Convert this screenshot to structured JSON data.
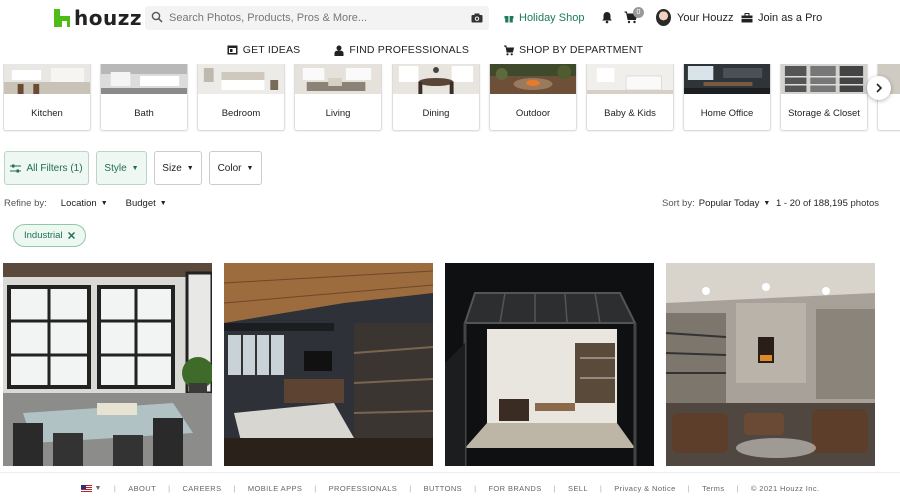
{
  "brand": {
    "name": "houzz",
    "color": "#4dbc15"
  },
  "search": {
    "placeholder": "Search Photos, Products, Pros & More..."
  },
  "header": {
    "holiday_shop": "Holiday Shop",
    "cart_count": "0",
    "your_houzz": "Your Houzz",
    "join_pro": "Join as a Pro"
  },
  "nav": [
    {
      "label": "GET IDEAS",
      "icon": "ideas-icon"
    },
    {
      "label": "FIND PROFESSIONALS",
      "icon": "professional-icon"
    },
    {
      "label": "SHOP BY DEPARTMENT",
      "icon": "shop-icon"
    }
  ],
  "categories": [
    "Kitchen",
    "Bath",
    "Bedroom",
    "Living",
    "Dining",
    "Outdoor",
    "Baby & Kids",
    "Home Office",
    "Storage & Closet"
  ],
  "filters": {
    "all_filters": "All Filters (1)",
    "style": "Style",
    "size": "Size",
    "color": "Color"
  },
  "refine": {
    "label": "Refine by:",
    "location": "Location",
    "budget": "Budget"
  },
  "sort": {
    "label": "Sort by:",
    "value": "Popular Today"
  },
  "results": {
    "range": "1 - 20",
    "of": "of",
    "total": "188,195",
    "unit": "photos"
  },
  "active_filter": {
    "label": "Industrial"
  },
  "footer": {
    "links": [
      "ABOUT",
      "CAREERS",
      "MOBILE APPS",
      "PROFESSIONALS",
      "BUTTONS",
      "FOR BRANDS",
      "SELL",
      "Privacy & Notice",
      "Terms"
    ],
    "copyright": "© 2021 Houzz Inc."
  },
  "colors": {
    "accent_green": "#1e7a5a",
    "chip_border": "#8fc9a8"
  }
}
